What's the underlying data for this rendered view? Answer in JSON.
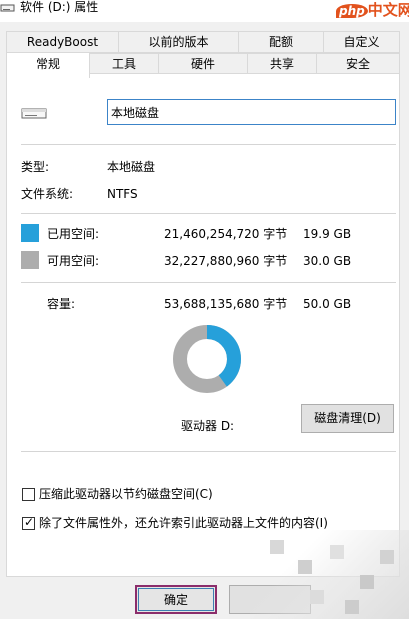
{
  "window": {
    "title": "软件 (D:) 属性",
    "watermark_badge": "php",
    "watermark_text": "中文网"
  },
  "tabs_row1": [
    {
      "label": "ReadyBoost"
    },
    {
      "label": "以前的版本"
    },
    {
      "label": "配额"
    },
    {
      "label": "自定义"
    }
  ],
  "tabs_row2": [
    {
      "label": "常规",
      "active": true
    },
    {
      "label": "工具"
    },
    {
      "label": "硬件"
    },
    {
      "label": "共享"
    },
    {
      "label": "安全"
    }
  ],
  "general": {
    "name_value": "本地磁盘",
    "type_label": "类型:",
    "type_value": "本地磁盘",
    "fs_label": "文件系统:",
    "fs_value": "NTFS",
    "used_label": "已用空间:",
    "used_bytes": "21,460,254,720 字节",
    "used_size": "19.9 GB",
    "free_label": "可用空间:",
    "free_bytes": "32,227,880,960 字节",
    "free_size": "30.0 GB",
    "capacity_label": "容量:",
    "capacity_bytes": "53,688,135,680 字节",
    "capacity_size": "50.0 GB",
    "drive_label": "驱动器 D:",
    "cleanup_button": "磁盘清理(D)",
    "compress_label": "压缩此驱动器以节约磁盘空间(C)",
    "compress_checked": false,
    "index_label": "除了文件属性外，还允许索引此驱动器上文件的内容(I)",
    "index_checked": true,
    "used_fraction": 0.4
  },
  "colors": {
    "used": "#26a0da",
    "free": "#adadad"
  },
  "footer": {
    "ok_button": "确定"
  }
}
